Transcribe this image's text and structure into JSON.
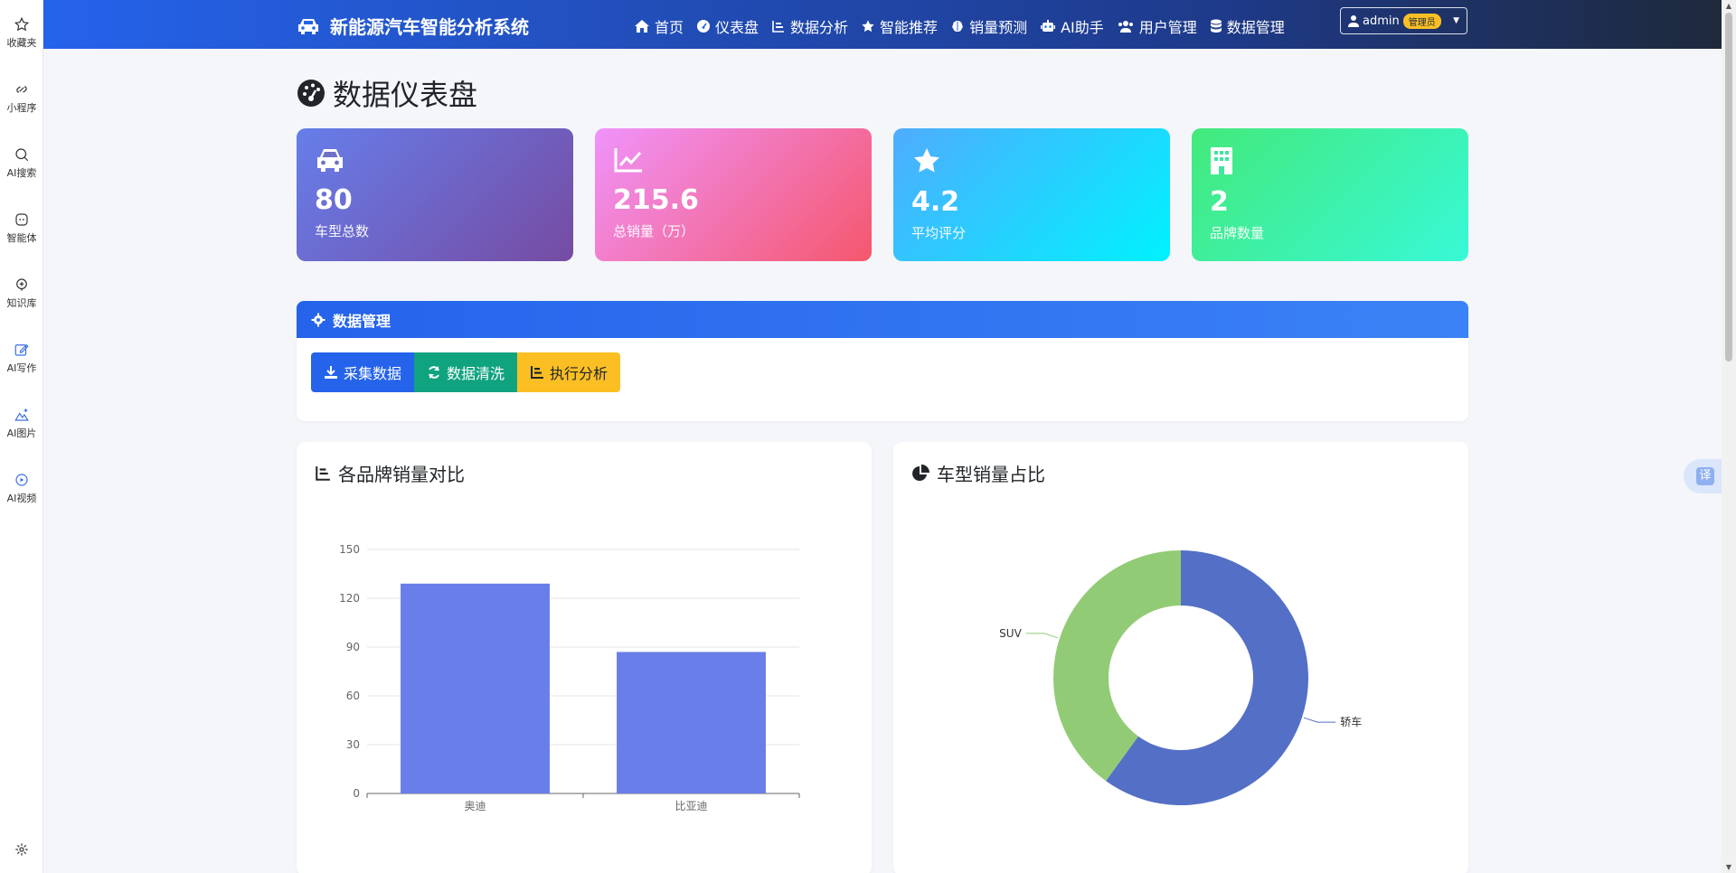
{
  "sidebar": {
    "items": [
      {
        "label": "收藏夹",
        "icon": "star-icon"
      },
      {
        "label": "小程序",
        "icon": "link-icon"
      },
      {
        "label": "AI搜索",
        "icon": "search-icon"
      },
      {
        "label": "智能体",
        "icon": "agent-icon"
      },
      {
        "label": "知识库",
        "icon": "knowledge-icon"
      },
      {
        "label": "AI写作",
        "icon": "edit-icon"
      },
      {
        "label": "AI图片",
        "icon": "image-icon"
      },
      {
        "label": "AI视频",
        "icon": "video-icon"
      }
    ],
    "settings_icon": "gear-icon"
  },
  "translate": {
    "label": "译"
  },
  "navbar": {
    "brand": "新能源汽车智能分析系统",
    "items": [
      {
        "label": "首页",
        "icon": "home-icon"
      },
      {
        "label": "仪表盘",
        "icon": "dashboard-icon"
      },
      {
        "label": "数据分析",
        "icon": "bar-chart-icon"
      },
      {
        "label": "智能推荐",
        "icon": "star-icon"
      },
      {
        "label": "销量预测",
        "icon": "brain-icon"
      },
      {
        "label": "AI助手",
        "icon": "robot-icon"
      },
      {
        "label": "用户管理",
        "icon": "users-icon"
      },
      {
        "label": "数据管理",
        "icon": "database-icon"
      }
    ],
    "user": {
      "name": "admin",
      "badge": "管理员"
    }
  },
  "page": {
    "title": "数据仪表盘"
  },
  "stats": [
    {
      "value": "80",
      "label": "车型总数",
      "icon": "car-icon",
      "gradient": [
        "#667eea",
        "#764ba2"
      ]
    },
    {
      "value": "215.6",
      "label": "总销量（万）",
      "icon": "line-chart-icon",
      "gradient": [
        "#f093fb",
        "#f5576c"
      ]
    },
    {
      "value": "4.2",
      "label": "平均评分",
      "icon": "star-icon",
      "gradient": [
        "#4facfe",
        "#00f2fe"
      ]
    },
    {
      "value": "2",
      "label": "品牌数量",
      "icon": "building-icon",
      "gradient": [
        "#43e97b",
        "#38f9d7"
      ]
    }
  ],
  "management": {
    "title": "数据管理",
    "buttons": [
      {
        "label": "采集数据",
        "icon": "download-icon",
        "color": "#2563eb"
      },
      {
        "label": "数据清洗",
        "icon": "refresh-icon",
        "color": "#10a37f"
      },
      {
        "label": "执行分析",
        "icon": "bar-chart-icon",
        "color": "#fbbf24"
      }
    ]
  },
  "chart_data": [
    {
      "type": "bar",
      "title": "各品牌销量对比",
      "categories": [
        "奥迪",
        "比亚迪"
      ],
      "values": [
        129,
        87
      ],
      "ylim": [
        0,
        150
      ],
      "yticks": [
        0,
        30,
        60,
        90,
        120,
        150
      ],
      "grid": true,
      "color": "#6a7ee9"
    },
    {
      "type": "pie",
      "title": "车型销量占比",
      "donut": true,
      "slices": [
        {
          "label": "轿车",
          "value": 60,
          "color": "#546fc6"
        },
        {
          "label": "SUV",
          "value": 40,
          "color": "#92cb75"
        }
      ]
    }
  ]
}
